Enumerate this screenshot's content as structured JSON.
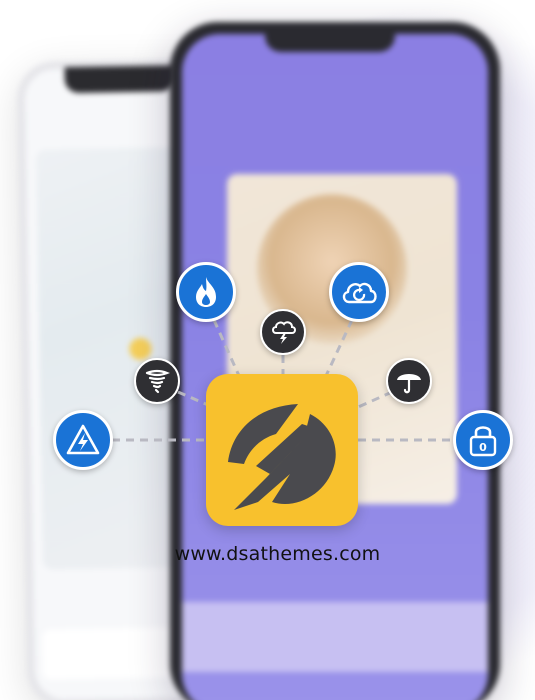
{
  "website": {
    "url": "www.dsathemes.com"
  },
  "colors": {
    "logo_background": "#f8c12d",
    "logo_mark": "#4a4a4e",
    "blue_icon": "#1a73d6",
    "dark_icon": "#2f2f33",
    "phone_screen": "#8b7fe3"
  },
  "icons": {
    "high_voltage": "high-voltage-icon",
    "tornado": "tornado-icon",
    "fire": "fire-icon",
    "thunderstorm": "thunderstorm-icon",
    "cloud_sync": "cloud-sync-icon",
    "umbrella": "umbrella-icon",
    "lock": "lock-icon",
    "app_logo": "app-logo"
  },
  "lock_label": "0"
}
